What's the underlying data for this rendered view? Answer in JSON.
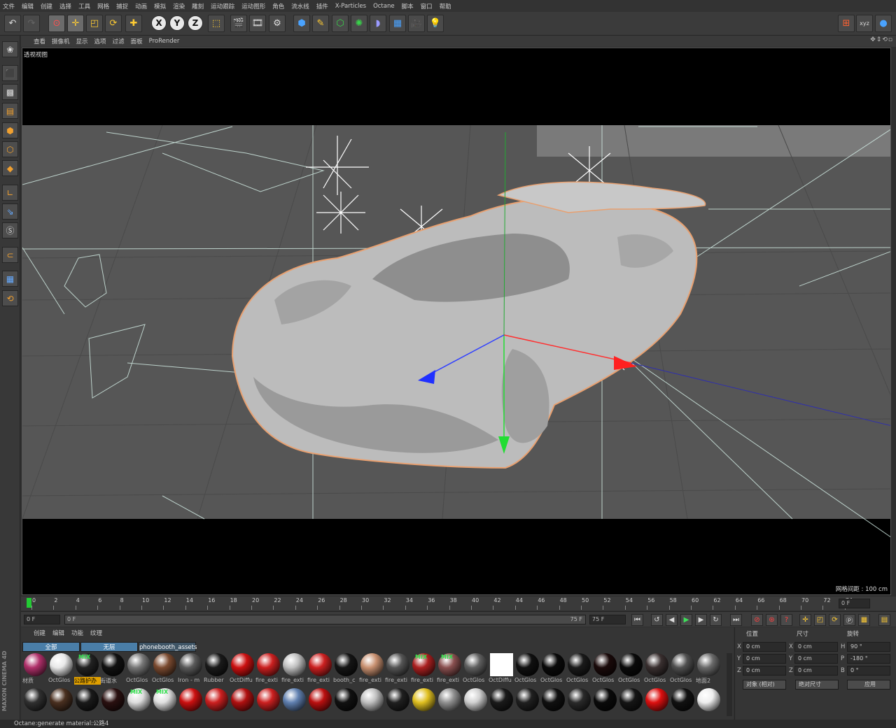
{
  "menu": [
    "文件",
    "编辑",
    "创建",
    "选择",
    "工具",
    "网格",
    "捕捉",
    "动画",
    "模拟",
    "渲染",
    "雕刻",
    "运动跟踪",
    "运动图形",
    "角色",
    "流水线",
    "插件",
    "X-Particles",
    "Octane",
    "脚本",
    "窗口",
    "帮助"
  ],
  "axis": {
    "x": "X",
    "y": "Y",
    "z": "Z"
  },
  "viewport": {
    "menu": [
      "查看",
      "摄像机",
      "显示",
      "选项",
      "过滤",
      "面板",
      "ProRender"
    ],
    "label": "透视视图",
    "grid": "网格间距 : 100 cm"
  },
  "timeline": {
    "ticks": [
      "0",
      "2",
      "4",
      "6",
      "8",
      "10",
      "12",
      "14",
      "16",
      "18",
      "20",
      "22",
      "24",
      "26",
      "28",
      "30",
      "32",
      "34",
      "36",
      "38",
      "40",
      "42",
      "44",
      "46",
      "48",
      "50",
      "52",
      "54",
      "56",
      "58",
      "60",
      "62",
      "64",
      "66",
      "68",
      "70",
      "72",
      "74"
    ],
    "current": "0 F",
    "start": "0 F",
    "slider_left": "0 F",
    "slider_right": "75 F",
    "end": "75 F"
  },
  "materials": {
    "menu": [
      "创建",
      "编辑",
      "功能",
      "纹理"
    ],
    "tabs": [
      "全部",
      "无层",
      "phonebooth_assets"
    ],
    "row1": [
      {
        "name": "材质",
        "color": "#b0306a",
        "tag": ""
      },
      {
        "name": "OctGlos",
        "color": "#e8e8e8",
        "tag": ""
      },
      {
        "name": "公路护办",
        "color": "#222222",
        "tag": "MIX"
      },
      {
        "name": "街道水",
        "color": "#111111",
        "tag": ""
      },
      {
        "name": "OctGlos",
        "color": "#777777",
        "tag": ""
      },
      {
        "name": "OctGlos",
        "color": "#7a4a30",
        "tag": ""
      },
      {
        "name": "Iron - m",
        "color": "#5a5a5a",
        "tag": ""
      },
      {
        "name": "Rubber",
        "color": "#1a1a1a",
        "tag": ""
      },
      {
        "name": "OctDiffu",
        "color": "#cc1010",
        "tag": ""
      },
      {
        "name": "fire_exti",
        "color": "#cc2020",
        "tag": ""
      },
      {
        "name": "fire_exti",
        "color": "#c0c0c0",
        "tag": ""
      },
      {
        "name": "fire_exti",
        "color": "#cc2020",
        "tag": ""
      },
      {
        "name": "booth_c",
        "color": "#151515",
        "tag": ""
      },
      {
        "name": "fire_exti",
        "color": "#c89070",
        "tag": ""
      },
      {
        "name": "fire_exti",
        "color": "#555555",
        "tag": ""
      },
      {
        "name": "fire_exti",
        "color": "#aa2020",
        "tag": "MIX"
      },
      {
        "name": "fire_exti",
        "color": "#8a5050",
        "tag": "MIX"
      },
      {
        "name": "OctGlos",
        "color": "#606060",
        "tag": ""
      },
      {
        "name": "OctDiffu",
        "color": "#ffffff",
        "tag": ""
      },
      {
        "name": "OctGlos",
        "color": "#101010",
        "tag": ""
      },
      {
        "name": "OctGlos",
        "color": "#0a0a0a",
        "tag": ""
      },
      {
        "name": "OctGlos",
        "color": "#1a1a1a",
        "tag": ""
      },
      {
        "name": "OctGlos",
        "color": "#1a0a0a",
        "tag": ""
      },
      {
        "name": "OctGlos",
        "color": "#0a0a0a",
        "tag": ""
      },
      {
        "name": "OctGlos",
        "color": "#3a3030",
        "tag": ""
      },
      {
        "name": "OctGlos",
        "color": "#505050",
        "tag": ""
      },
      {
        "name": "地面2",
        "color": "#6a6a6a",
        "tag": ""
      }
    ],
    "row2": [
      {
        "color": "#303030",
        "tag": ""
      },
      {
        "color": "#4a3020",
        "tag": ""
      },
      {
        "color": "#1a1a1a",
        "tag": ""
      },
      {
        "color": "#2a1010",
        "tag": ""
      },
      {
        "color": "#dddddd",
        "tag": "MIX"
      },
      {
        "color": "#e0e0e0",
        "tag": "MIX"
      },
      {
        "color": "#cc1010",
        "tag": ""
      },
      {
        "color": "#cc2020",
        "tag": ""
      },
      {
        "color": "#b01010",
        "tag": ""
      },
      {
        "color": "#cc2020",
        "tag": ""
      },
      {
        "color": "#6080b0",
        "tag": ""
      },
      {
        "color": "#bb1010",
        "tag": ""
      },
      {
        "color": "#111111",
        "tag": ""
      },
      {
        "color": "#c0c0c0",
        "tag": ""
      },
      {
        "color": "#202020",
        "tag": ""
      },
      {
        "color": "#e0c020",
        "tag": ""
      },
      {
        "color": "#909090",
        "tag": ""
      },
      {
        "color": "#d0d0d0",
        "tag": ""
      },
      {
        "color": "#1a1a1a",
        "tag": ""
      },
      {
        "color": "#202020",
        "tag": ""
      },
      {
        "color": "#101010",
        "tag": ""
      },
      {
        "color": "#2a2a2a",
        "tag": ""
      },
      {
        "color": "#0a0a0a",
        "tag": ""
      },
      {
        "color": "#151515",
        "tag": ""
      },
      {
        "color": "#dd1010",
        "tag": ""
      },
      {
        "color": "#111111",
        "tag": ""
      },
      {
        "color": "#eeeeee",
        "tag": ""
      }
    ]
  },
  "attributes": {
    "headers": {
      "pos": "位置",
      "size": "尺寸",
      "rot": "旋转"
    },
    "rows": [
      {
        "axis": "X",
        "pos": "0 cm",
        "saxis": "X",
        "size": "0 cm",
        "raxis": "H",
        "rot": "90 °"
      },
      {
        "axis": "Y",
        "pos": "0 cm",
        "saxis": "Y",
        "size": "0 cm",
        "raxis": "P",
        "rot": "-180 °"
      },
      {
        "axis": "Z",
        "pos": "0 cm",
        "saxis": "Z",
        "size": "0 cm",
        "raxis": "B",
        "rot": "0 °"
      }
    ],
    "mode": "对象 (相对)",
    "sizemode": "绝对尺寸",
    "apply": "应用"
  },
  "status": "Octane:generate material:公路4",
  "brand": "MAXON CINEMA 4D"
}
